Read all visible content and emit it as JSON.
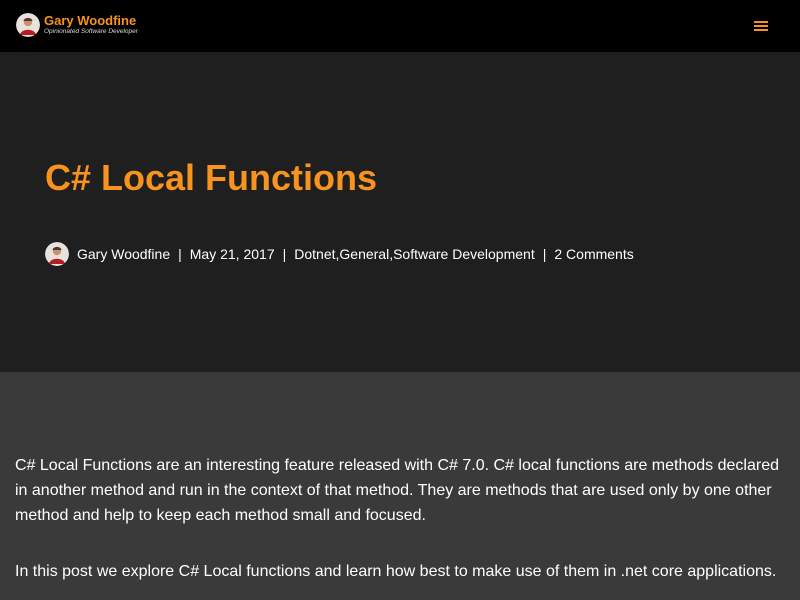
{
  "header": {
    "brand_name": "Gary Woodfine",
    "brand_tagline": "Opinionated Software Developer",
    "avatar_icon": "author-avatar-icon",
    "menu_icon": "hamburger-menu-icon",
    "accent_color": "#f7931e"
  },
  "post": {
    "title": "C# Local Functions",
    "author": "Gary Woodfine",
    "separator": "|",
    "date": "May 21, 2017",
    "categories": [
      "Dotnet",
      "General",
      "Software Development"
    ],
    "category_separator": ", ",
    "comments": "2 Comments"
  },
  "content": {
    "paragraphs": [
      "C# Local Functions are an interesting feature released with C# 7.0. C# local functions are methods declared in another method and run in the context of that method. They are methods that are used only by one other method and help to keep each method small and focused.",
      "In this post we explore C# Local functions and learn how best to make use of them in .net core applications."
    ]
  }
}
